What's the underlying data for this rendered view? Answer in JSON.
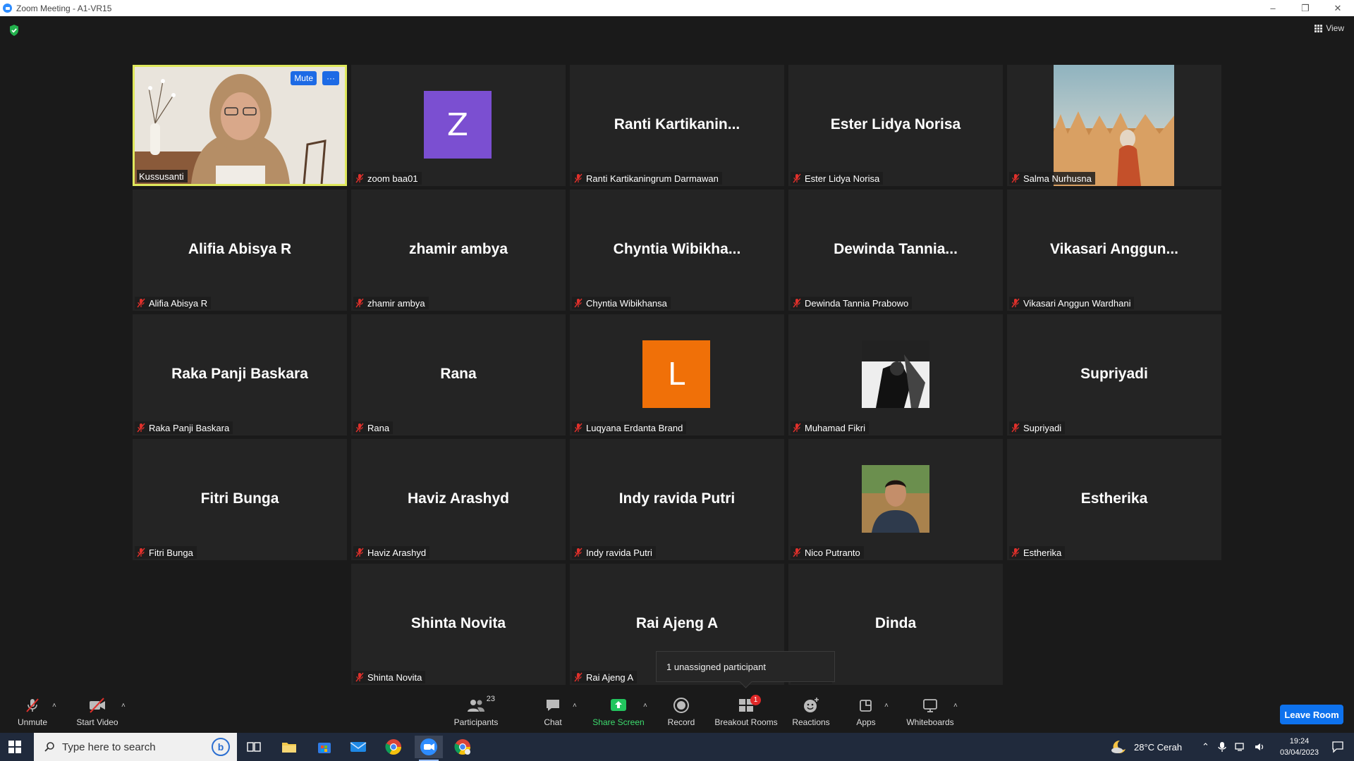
{
  "window": {
    "title": "Zoom Meeting - A1-VR15"
  },
  "view_label": "View",
  "tiles": [
    {
      "display": "",
      "label": "Kussusanti",
      "kind": "video-active"
    },
    {
      "display": "Z",
      "label": "zoom baa01",
      "kind": "avatar",
      "color": "#7b4fd1"
    },
    {
      "display": "Ranti  Kartikanin...",
      "label": "Ranti Kartikaningrum Darmawan",
      "kind": "name"
    },
    {
      "display": "Ester Lidya Norisa",
      "label": "Ester Lidya Norisa",
      "kind": "name"
    },
    {
      "display": "",
      "label": "Salma Nurhusna",
      "kind": "photo-field"
    },
    {
      "display": "Alifia Abisya R",
      "label": "Alifia Abisya R",
      "kind": "name"
    },
    {
      "display": "zhamir ambya",
      "label": "zhamir ambya",
      "kind": "name"
    },
    {
      "display": "Chyntia  Wibikha...",
      "label": "Chyntia Wibikhansa",
      "kind": "name"
    },
    {
      "display": "Dewinda  Tannia...",
      "label": "Dewinda Tannia Prabowo",
      "kind": "name"
    },
    {
      "display": "Vikasari  Anggun...",
      "label": "Vikasari Anggun Wardhani",
      "kind": "name"
    },
    {
      "display": "Raka Panji Baskara",
      "label": "Raka Panji Baskara",
      "kind": "name"
    },
    {
      "display": "Rana",
      "label": "Rana",
      "kind": "name"
    },
    {
      "display": "L",
      "label": "Luqyana Erdanta Brand",
      "kind": "avatar",
      "color": "#f07008"
    },
    {
      "display": "",
      "label": "Muhamad Fikri",
      "kind": "photo-bw"
    },
    {
      "display": "Supriyadi",
      "label": "Supriyadi",
      "kind": "name"
    },
    {
      "display": "Fitri Bunga",
      "label": "Fitri Bunga",
      "kind": "name"
    },
    {
      "display": "Haviz Arashyd",
      "label": "Haviz Arashyd",
      "kind": "name"
    },
    {
      "display": "Indy ravida Putri",
      "label": "Indy ravida Putri",
      "kind": "name"
    },
    {
      "display": "",
      "label": "Nico Putranto",
      "kind": "photo-man"
    },
    {
      "display": "Estherika",
      "label": "Estherika",
      "kind": "name"
    },
    {
      "display": "Shinta  Novita",
      "label": "Shinta  Novita",
      "kind": "name"
    },
    {
      "display": "Rai Ajeng A",
      "label": "Rai Ajeng A",
      "kind": "name"
    },
    {
      "display": "Dinda",
      "label": "Dinda",
      "kind": "name"
    }
  ],
  "active_tile": {
    "mute_label": "Mute",
    "more_label": "···"
  },
  "tooltip": {
    "text": "1 unassigned participant"
  },
  "toolbar": {
    "unmute": "Unmute",
    "start_video": "Start Video",
    "participants": "Participants",
    "participants_count": "23",
    "chat": "Chat",
    "share_screen": "Share Screen",
    "record": "Record",
    "breakout_rooms": "Breakout Rooms",
    "breakout_badge": "1",
    "reactions": "Reactions",
    "apps": "Apps",
    "whiteboards": "Whiteboards",
    "leave_room": "Leave Room",
    "caret": "˄"
  },
  "taskbar": {
    "search_placeholder": "Type here to search",
    "weather": "28°C  Cerah",
    "time": "19:24",
    "date": "03/04/2023"
  },
  "colors": {
    "accent_blue": "#0e72ed",
    "share_green": "#22c55e",
    "active_border": "#dfe85c",
    "mic_off_red": "#e0302b"
  }
}
